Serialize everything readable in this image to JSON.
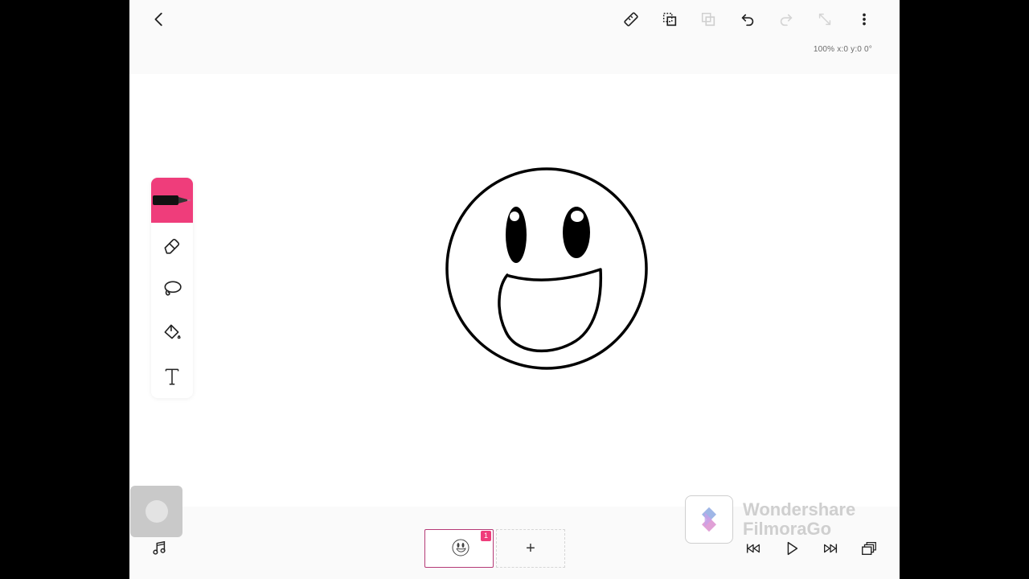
{
  "toolbar_top": {
    "back": "back-icon",
    "ruler": "ruler-icon",
    "copy": "copy-icon",
    "paste": "paste-icon",
    "undo": "undo-icon",
    "redo": "redo-icon",
    "resize": "resize-icon",
    "more": "more-icon",
    "zoom_readout": "100% x:0 y:0 0°"
  },
  "tools": [
    {
      "name": "pen-tool",
      "icon": "pen-icon",
      "active": true
    },
    {
      "name": "eraser-tool",
      "icon": "eraser-icon",
      "active": false
    },
    {
      "name": "lasso-tool",
      "icon": "lasso-icon",
      "active": false
    },
    {
      "name": "fill-tool",
      "icon": "paint-bucket-icon",
      "active": false
    },
    {
      "name": "text-tool",
      "icon": "text-icon",
      "active": false
    }
  ],
  "frames": {
    "current_badge": "1",
    "add_label": "+"
  },
  "playback": {
    "music": "music-note-icon",
    "previous": "skip-back-icon",
    "play": "play-icon",
    "next": "skip-forward-icon",
    "layers": "layers-icon"
  },
  "watermark": {
    "line1": "Wondershare",
    "line2": "FilmoraGo"
  },
  "colors": {
    "accent": "#ef3d7b",
    "frame_border": "#b53a76"
  }
}
